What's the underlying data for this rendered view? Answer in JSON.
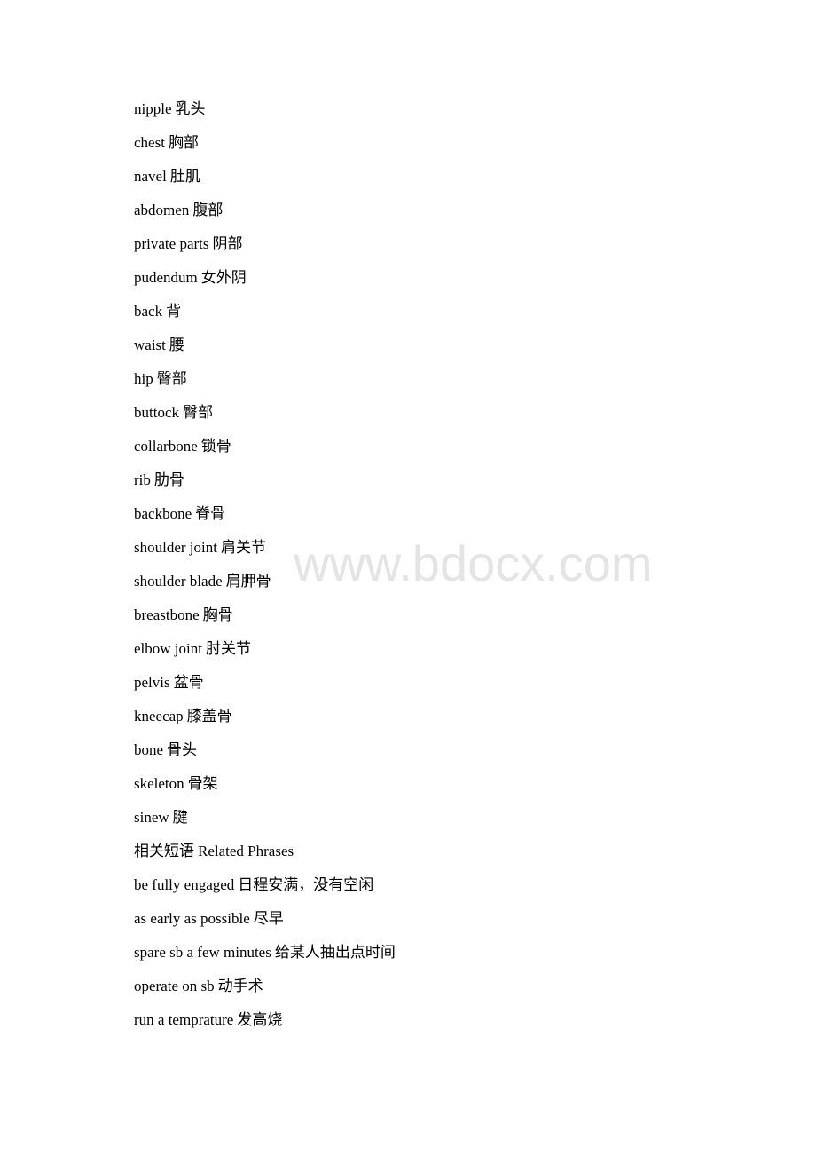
{
  "watermark": "www.bdocx.com",
  "entries": [
    {
      "en": "nipple",
      "zh": "乳头"
    },
    {
      "en": "chest",
      "zh": "胸部"
    },
    {
      "en": "navel",
      "zh": "肚肌"
    },
    {
      "en": "abdomen",
      "zh": "腹部"
    },
    {
      "en": "private parts",
      "zh": "阴部"
    },
    {
      "en": "pudendum",
      "zh": "女外阴"
    },
    {
      "en": "back",
      "zh": "背"
    },
    {
      "en": "waist",
      "zh": "腰"
    },
    {
      "en": "hip",
      "zh": "臀部"
    },
    {
      "en": "buttock",
      "zh": "臀部"
    },
    {
      "en": "collarbone",
      "zh": "锁骨"
    },
    {
      "en": "rib",
      "zh": "肋骨"
    },
    {
      "en": "backbone",
      "zh": "脊骨"
    },
    {
      "en": "shoulder joint",
      "zh": "肩关节"
    },
    {
      "en": "shoulder blade",
      "zh": "肩胛骨"
    },
    {
      "en": "breastbone",
      "zh": "胸骨"
    },
    {
      "en": "elbow joint",
      "zh": "肘关节"
    },
    {
      "en": "pelvis",
      "zh": "盆骨"
    },
    {
      "en": "kneecap",
      "zh": "膝盖骨"
    },
    {
      "en": "bone",
      "zh": "骨头"
    },
    {
      "en": "skeleton",
      "zh": "骨架"
    },
    {
      "en": "sinew",
      "zh": "腱"
    },
    {
      "en": "相关短语",
      "zh": "Related Phrases"
    },
    {
      "en": "be fully engaged",
      "zh": "日程安满，没有空闲"
    },
    {
      "en": "as early as possible",
      "zh": "尽早"
    },
    {
      "en": "spare sb a few minutes",
      "zh": "给某人抽出点时间"
    },
    {
      "en": "operate on sb",
      "zh": "动手术"
    },
    {
      "en": "run a temprature",
      "zh": "发高烧"
    }
  ]
}
